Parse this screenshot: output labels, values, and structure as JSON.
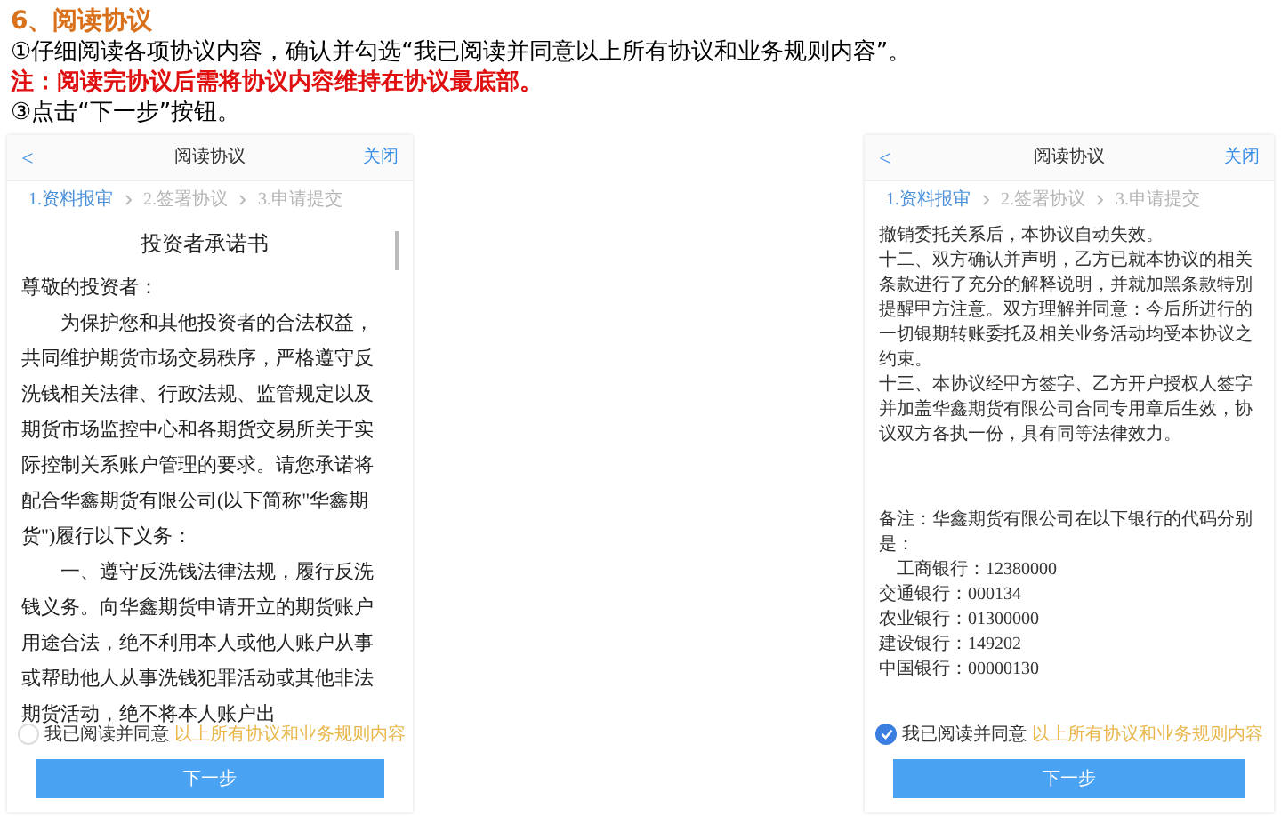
{
  "heading": "6、阅读协议",
  "instructions": [
    {
      "kind": "normal",
      "text": "①仔细阅读各项协议内容，确认并勾选“我已阅读并同意以上所有协议和业务规则内容”。"
    },
    {
      "kind": "warning",
      "text": "注：阅读完协议后需将协议内容维持在协议最底部。"
    },
    {
      "kind": "normal",
      "text": "③点击“下一步”按钮。"
    }
  ],
  "screens": [
    {
      "back": "<",
      "title": "阅读协议",
      "close": "关闭",
      "steps": [
        {
          "label": "1.资料报审",
          "selected": true
        },
        {
          "label": "2.签署协议",
          "selected": false
        },
        {
          "label": "3.申请提交",
          "selected": false
        }
      ],
      "scrollbar": true,
      "blocks": [
        {
          "kind": "title",
          "text": "投资者承诺书"
        },
        {
          "kind": "plain",
          "text": "尊敬的投资者："
        },
        {
          "kind": "indented",
          "text": "为保护您和其他投资者的合法权益，共同维护期货市场交易秩序，严格遵守反洗钱相关法律、行政法规、监管规定以及期货市场监控中心和各期货交易所关于实际控制关系账户管理的要求。请您承诺将配合华鑫期货有限公司(以下简称\"华鑫期货\")履行以下义务："
        },
        {
          "kind": "indented",
          "text": "一、遵守反洗钱法律法规，履行反洗钱义务。向华鑫期货申请开立的期货账户用途合法，绝不利用本人或他人账户从事或帮助他人从事洗钱犯罪活动或其他非法期货活动，绝不将本人账户出"
        }
      ],
      "agree": {
        "label": "我已阅读并同意",
        "link": "以上所有协议和业务规则内容",
        "checked": false
      },
      "button": "下一步"
    },
    {
      "back": "<",
      "title": "阅读协议",
      "close": "关闭",
      "steps": [
        {
          "label": "1.资料报审",
          "selected": true
        },
        {
          "label": "2.签署协议",
          "selected": false
        },
        {
          "label": "3.申请提交",
          "selected": false
        }
      ],
      "scrollbar": false,
      "blocks": [
        {
          "kind": "small",
          "text": "撤销委托关系后，本协议自动失效。"
        },
        {
          "kind": "small",
          "text": "十二、双方确认并声明，乙方已就本协议的相关条款进行了充分的解释说明，并就加黑条款特别提醒甲方注意。双方理解并同意：今后所进行的一切银期转账委托及相关业务活动均受本协议之约束。"
        },
        {
          "kind": "small",
          "text": "十三、本协议经甲方签字、乙方开户授权人签字并加盖华鑫期货有限公司合同专用章后生效，协议双方各执一份，具有同等法律效力。"
        },
        {
          "kind": "gap"
        },
        {
          "kind": "small",
          "text": "备注：华鑫期货有限公司在以下银行的代码分别是："
        },
        {
          "kind": "small-indented",
          "text": "工商银行：12380000"
        },
        {
          "kind": "small",
          "text": "交通银行：000134"
        },
        {
          "kind": "small",
          "text": "农业银行：01300000"
        },
        {
          "kind": "small",
          "text": "建设银行：149202"
        },
        {
          "kind": "small",
          "text": "中国银行：00000130"
        }
      ],
      "agree": {
        "label": "我已阅读并同意",
        "link": "以上所有协议和业务规则内容",
        "checked": true
      },
      "button": "下一步"
    }
  ]
}
